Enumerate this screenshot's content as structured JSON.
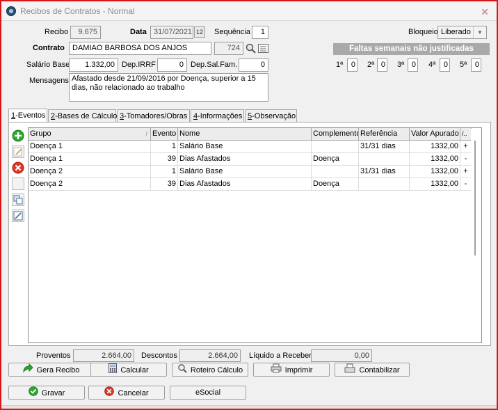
{
  "window": {
    "title": "Recibos de Contratos - Normal"
  },
  "header": {
    "recibo_label": "Recibo",
    "recibo_value": "9.675",
    "data_label": "Data",
    "data_value": "31/07/2021",
    "sequencia_label": "Sequência",
    "sequencia_value": "1",
    "bloqueio_label": "Bloqueio",
    "bloqueio_value": "Liberado",
    "contrato_label": "Contrato",
    "contrato_value": "DAMIAO BARBOSA DOS ANJOS",
    "contrato_code": "724",
    "salario_label": "Salário Base",
    "salario_value": "1.332,00",
    "dep_irrf_label": "Dep.IRRF",
    "dep_irrf_value": "0",
    "dep_salfam_label": "Dep.Sal.Fam.",
    "dep_salfam_value": "0",
    "mensagens_label": "Mensagens",
    "mensagens_value": "Afastado desde 21/09/2016 por Doença, superior a 15 dias, não relacionado ao trabalho"
  },
  "faltas": {
    "title": "Faltas semanais não justificadas",
    "weeks": [
      {
        "label": "1ª",
        "value": "0"
      },
      {
        "label": "2ª",
        "value": "0"
      },
      {
        "label": "3ª",
        "value": "0"
      },
      {
        "label": "4ª",
        "value": "0"
      },
      {
        "label": "5ª",
        "value": "0"
      }
    ]
  },
  "tabs": [
    {
      "key": "1",
      "label": "-Eventos"
    },
    {
      "key": "2",
      "label": "-Bases de Cálculo"
    },
    {
      "key": "3",
      "label": "-Tomadores/Obras"
    },
    {
      "key": "4",
      "label": "-Informações"
    },
    {
      "key": "5",
      "label": "-Observação"
    }
  ],
  "grid": {
    "columns": [
      "Grupo",
      "Evento",
      "Nome",
      "Complemento",
      "Referência",
      "Valor Apurado",
      "/.."
    ],
    "rows": [
      {
        "grupo": "Doença 1",
        "evento": "1",
        "nome": "Salário Base",
        "complemento": "",
        "referencia": "31/31 dias",
        "valor": "1332,00",
        "sinal": "+"
      },
      {
        "grupo": "Doença 1",
        "evento": "39",
        "nome": "Dias Afastados",
        "complemento": "Doença",
        "referencia": "",
        "valor": "1332,00",
        "sinal": "-"
      },
      {
        "grupo": "Doença 2",
        "evento": "1",
        "nome": "Salário Base",
        "complemento": "",
        "referencia": "31/31 dias",
        "valor": "1332,00",
        "sinal": "+"
      },
      {
        "grupo": "Doença 2",
        "evento": "39",
        "nome": "Dias Afastados",
        "complemento": "Doença",
        "referencia": "",
        "valor": "1332,00",
        "sinal": "-"
      }
    ]
  },
  "totals": {
    "proventos_label": "Proventos",
    "proventos_value": "2.664,00",
    "descontos_label": "Descontos",
    "descontos_value": "2.664,00",
    "liquido_label": "Líquido a Receber",
    "liquido_value": "0,00"
  },
  "actions": {
    "gera_recibo": "Gera Recibo",
    "calcular": "Calcular",
    "roteiro": "Roteiro Cálculo",
    "imprimir": "Imprimir",
    "contabilizar": "Contabilizar",
    "gravar": "Gravar",
    "cancelar": "Cancelar",
    "esocial": "eSocial"
  },
  "colors": {
    "window_border": "#d81818",
    "faltas_banner": "#a9a9a9",
    "add_green": "#2fa82f",
    "delete_red": "#d93a2a"
  }
}
